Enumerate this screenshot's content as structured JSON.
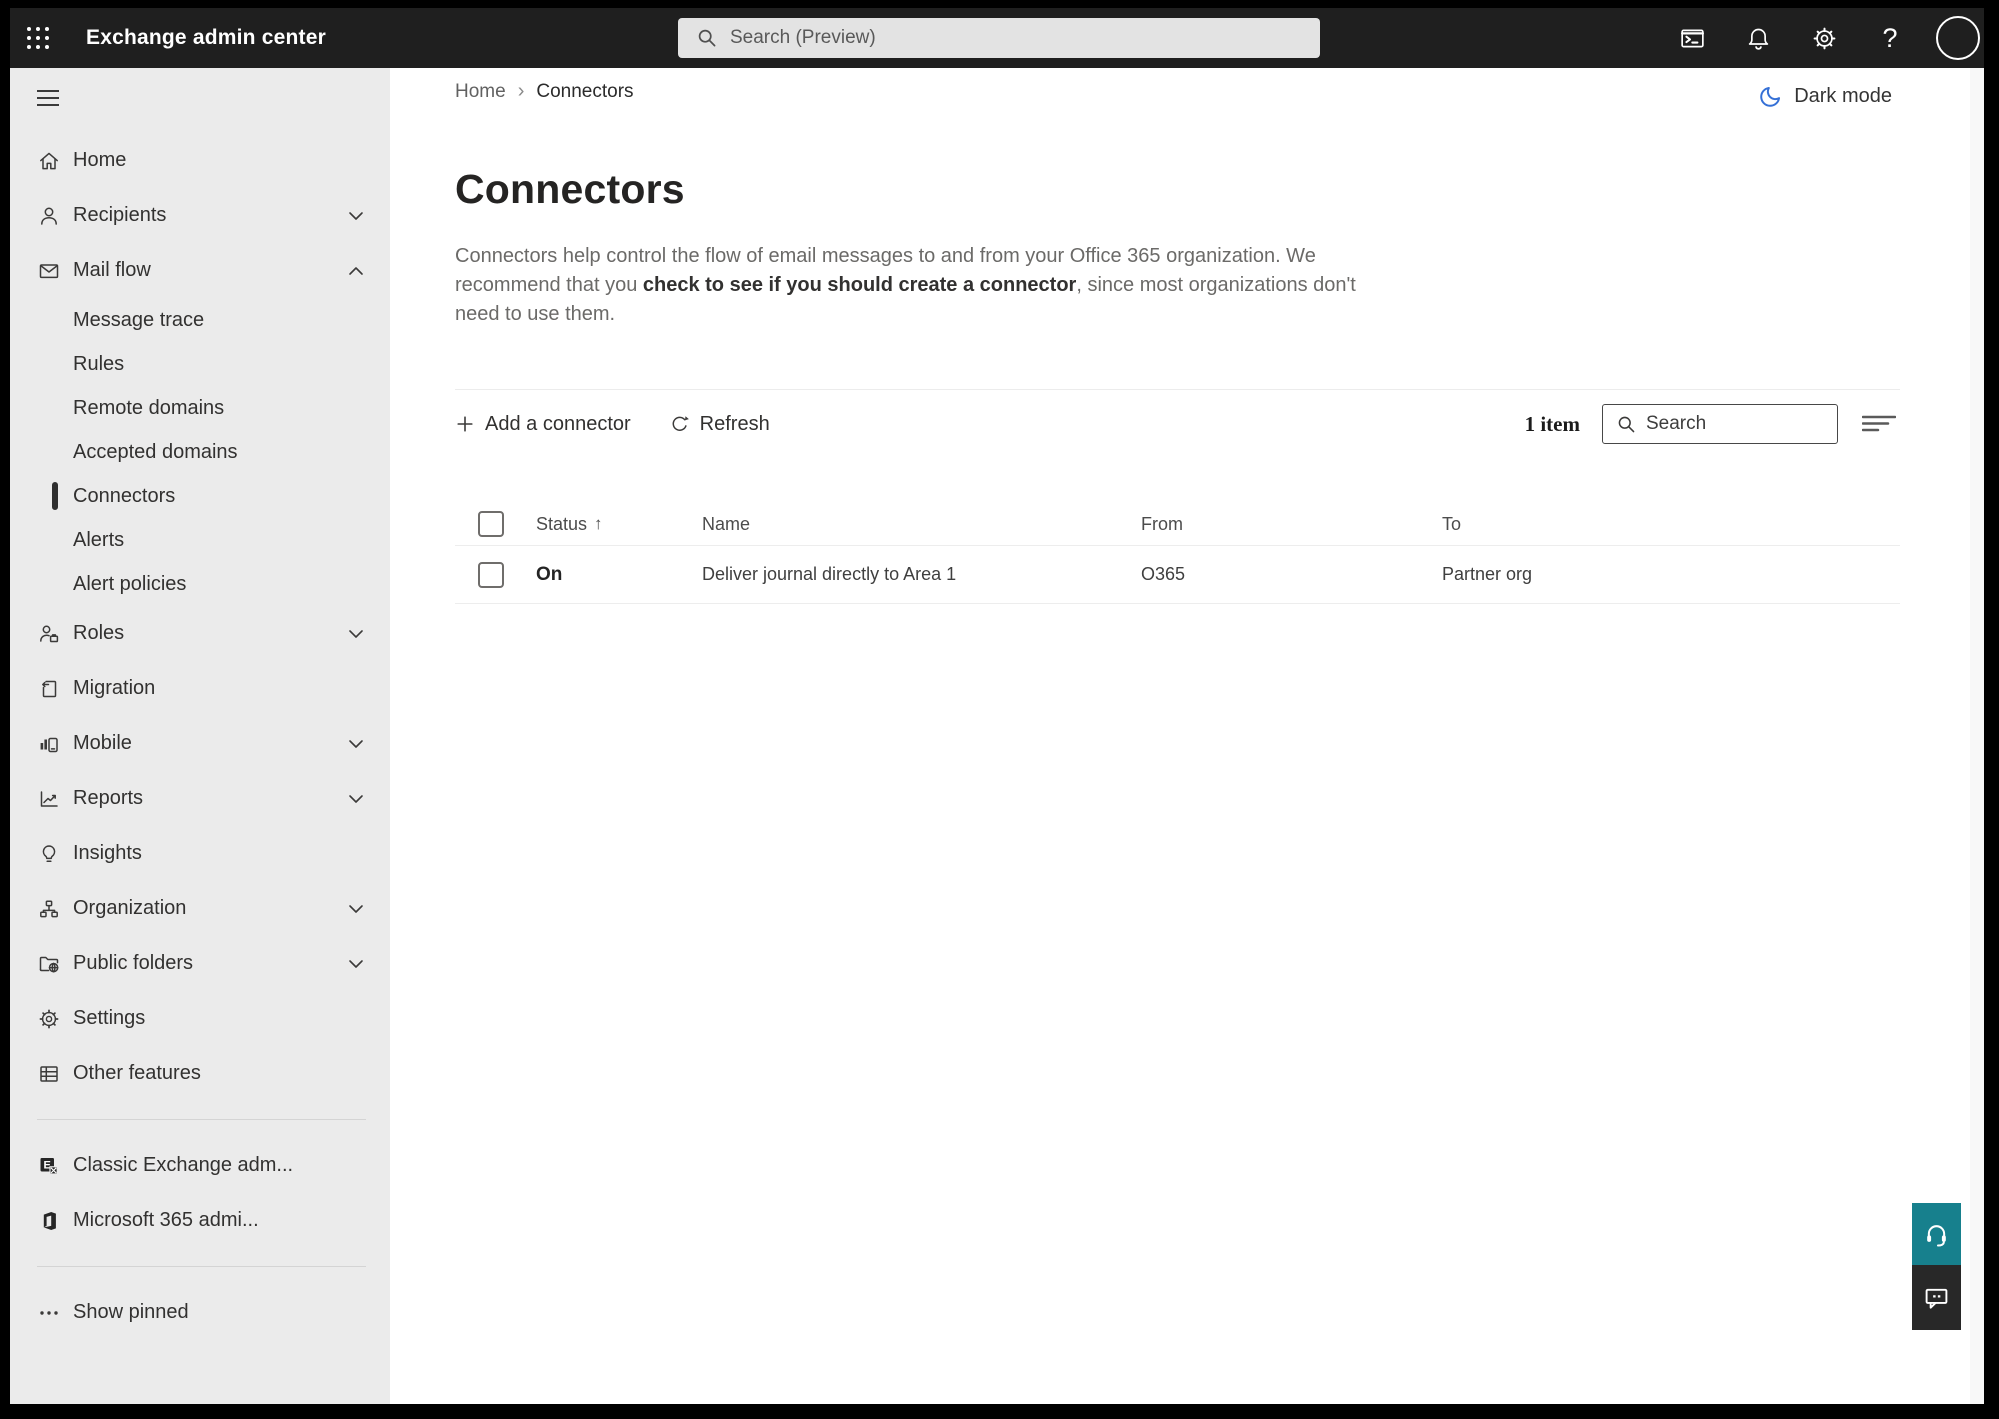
{
  "topbar": {
    "title": "Exchange admin center",
    "search_placeholder": "Search (Preview)"
  },
  "glyphs": {
    "help": "?",
    "breadcrumb_separator": "›",
    "sort_ascending": "↑"
  },
  "icons": {
    "app_launcher": "waffle-grid",
    "global_search": "magnifier",
    "terminal": "powershell-window",
    "notifications": "bell",
    "settings": "gear",
    "help": "question-mark",
    "account": "circle-avatar",
    "dark_mode": "crescent-moon",
    "add": "plus",
    "refresh": "circular-arrow",
    "filter": "sort-lines",
    "support": "headset",
    "feedback": "speech-bubble"
  },
  "colors": {
    "topbar_bg": "#1f1f1f",
    "sidebar_bg": "#ebebeb",
    "accent_moon_blue": "#3570d6",
    "support_teal": "#17808d",
    "feedback_dark": "#282828",
    "selected_indicator": "#2f2f2f"
  },
  "sidebar": {
    "items": [
      {
        "label": "Home"
      },
      {
        "label": "Recipients"
      },
      {
        "label": "Mail flow"
      },
      {
        "label": "Message trace"
      },
      {
        "label": "Rules"
      },
      {
        "label": "Remote domains"
      },
      {
        "label": "Accepted domains"
      },
      {
        "label": "Connectors",
        "selected": true
      },
      {
        "label": "Alerts"
      },
      {
        "label": "Alert policies"
      },
      {
        "label": "Roles"
      },
      {
        "label": "Migration"
      },
      {
        "label": "Mobile"
      },
      {
        "label": "Reports"
      },
      {
        "label": "Insights"
      },
      {
        "label": "Organization"
      },
      {
        "label": "Public folders"
      },
      {
        "label": "Settings"
      },
      {
        "label": "Other features"
      },
      {
        "label": "Classic Exchange adm..."
      },
      {
        "label": "Microsoft 365 admi..."
      },
      {
        "label": "Show pinned"
      }
    ]
  },
  "breadcrumb": {
    "home": "Home",
    "separator": "›",
    "current": "Connectors"
  },
  "darkmode": {
    "label": "Dark mode"
  },
  "page": {
    "title": "Connectors",
    "description": {
      "line1": "Connectors help control the flow of email messages to and from your Office 365 organization. We",
      "line2_pre": "recommend that you ",
      "line2_link": "check to see if you should create a connector",
      "line2_post": ", since most organizations don't",
      "line3": "need to use them."
    }
  },
  "toolbar": {
    "add_label": "Add a connector",
    "refresh_label": "Refresh",
    "item_count": "1 item",
    "search_placeholder": "Search"
  },
  "table": {
    "headers": {
      "status": "Status",
      "sort_icon": "↑",
      "name": "Name",
      "from": "From",
      "to": "To"
    },
    "rows": [
      {
        "status": "On",
        "name": "Deliver journal directly to Area 1",
        "from": "O365",
        "to": "Partner org"
      }
    ]
  }
}
